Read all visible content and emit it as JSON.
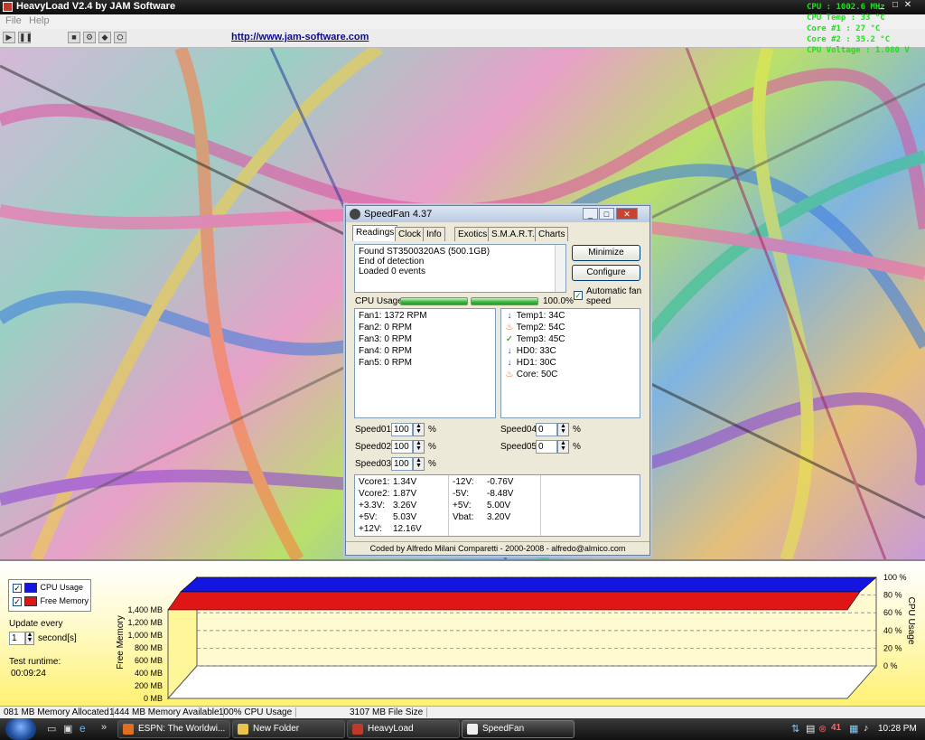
{
  "app": {
    "title": "HeavyLoad V2.4   by JAM Software",
    "menu": [
      "File",
      "Help"
    ],
    "url": "http://www.jam-software.com"
  },
  "osd": [
    "CPU : 1002.6 MHz",
    "CPU Temp : 33 °C",
    "Core #1 : 27 °C",
    "Core #2 : 35.2 °C",
    "CPU Voltage : 1.080 V"
  ],
  "speedfan": {
    "title": "SpeedFan 4.37",
    "tabs": [
      "Readings",
      "Clock",
      "Info",
      "Exotics",
      "S.M.A.R.T.",
      "Charts"
    ],
    "log": [
      "Found ST3500320AS (500.1GB)",
      "End of detection",
      "Loaded 0 events"
    ],
    "minimize_label": "Minimize",
    "configure_label": "Configure",
    "auto_fan_label": "Automatic fan speed",
    "cpu_usage_label": "CPU Usage",
    "cpu_usage_value": "100.0%",
    "cpu_usage_level": 1.0,
    "fans": [
      "Fan1: 1372 RPM",
      "Fan2: 0 RPM",
      "Fan3: 0 RPM",
      "Fan4: 0 RPM",
      "Fan5: 0 RPM"
    ],
    "temps": [
      {
        "label": "Temp1:",
        "value": "34C",
        "icon": "arrow-down-icon"
      },
      {
        "label": "Temp2:",
        "value": "54C",
        "icon": "flame-icon"
      },
      {
        "label": "Temp3:",
        "value": "45C",
        "icon": "check-icon"
      },
      {
        "label": "HD0:",
        "value": "33C",
        "icon": "arrow-down-icon"
      },
      {
        "label": "HD1:",
        "value": "30C",
        "icon": "arrow-down-icon"
      },
      {
        "label": "Core:",
        "value": "50C",
        "icon": "flame-icon"
      }
    ],
    "speeds_left": [
      {
        "label": "Speed01:",
        "value": "100"
      },
      {
        "label": "Speed02:",
        "value": "100"
      },
      {
        "label": "Speed03:",
        "value": "100"
      }
    ],
    "speeds_right": [
      {
        "label": "Speed04:",
        "value": "0"
      },
      {
        "label": "Speed05:",
        "value": "0"
      }
    ],
    "percent": "%",
    "volts_left": [
      {
        "label": "Vcore1:",
        "value": "1.34V"
      },
      {
        "label": "Vcore2:",
        "value": "1.87V"
      },
      {
        "label": "+3.3V:",
        "value": "3.26V"
      },
      {
        "label": "+5V:",
        "value": "5.03V"
      },
      {
        "label": "+12V:",
        "value": "12.16V"
      }
    ],
    "volts_right": [
      {
        "label": "-12V:",
        "value": "-0.76V"
      },
      {
        "label": "-5V:",
        "value": "-8.48V"
      },
      {
        "label": "+5V:",
        "value": "5.00V"
      },
      {
        "label": "Vbat:",
        "value": "3.20V"
      }
    ],
    "footer": "Coded by Alfredo Milani Comparetti - 2000-2008 - alfredo@almico.com"
  },
  "graph": {
    "legend": [
      {
        "label": "CPU Usage",
        "color": "#1515e0"
      },
      {
        "label": "Free Memory",
        "color": "#e01515"
      }
    ],
    "update_label": "Update every",
    "update_value": "1",
    "update_unit": "second[s]",
    "runtime_label": "Test runtime:",
    "runtime_value": "00:09:24",
    "left_axis_title": "Free Memory",
    "right_axis_title": "CPU Usage"
  },
  "chart_data": {
    "type": "area",
    "yleft_ticks": [
      "1,400 MB",
      "1,200 MB",
      "1,000 MB",
      "800 MB",
      "600 MB",
      "400 MB",
      "200 MB",
      "0 MB"
    ],
    "yright_ticks": [
      "100 %",
      "80 %",
      "60 %",
      "40 %",
      "20 %",
      "0 %"
    ],
    "ylim_left": [
      0,
      1400
    ],
    "ylim_right": [
      0,
      100
    ],
    "series": [
      {
        "name": "CPU Usage",
        "value": 100
      },
      {
        "name": "Free Memory",
        "value": 1444
      }
    ]
  },
  "status": [
    "081 MB Memory Allocated",
    "1444 MB Memory Available",
    "100% CPU Usage",
    "3107 MB File Size"
  ],
  "taskbar": {
    "items": [
      {
        "label": "ESPN: The Worldwi...",
        "color": "#e07020"
      },
      {
        "label": "New Folder",
        "color": "#e8c44a"
      },
      {
        "label": "HeavyLoad",
        "color": "#c0392b"
      },
      {
        "label": "SpeedFan",
        "color": "#eeeeee"
      }
    ],
    "clock": "10:28 PM"
  }
}
